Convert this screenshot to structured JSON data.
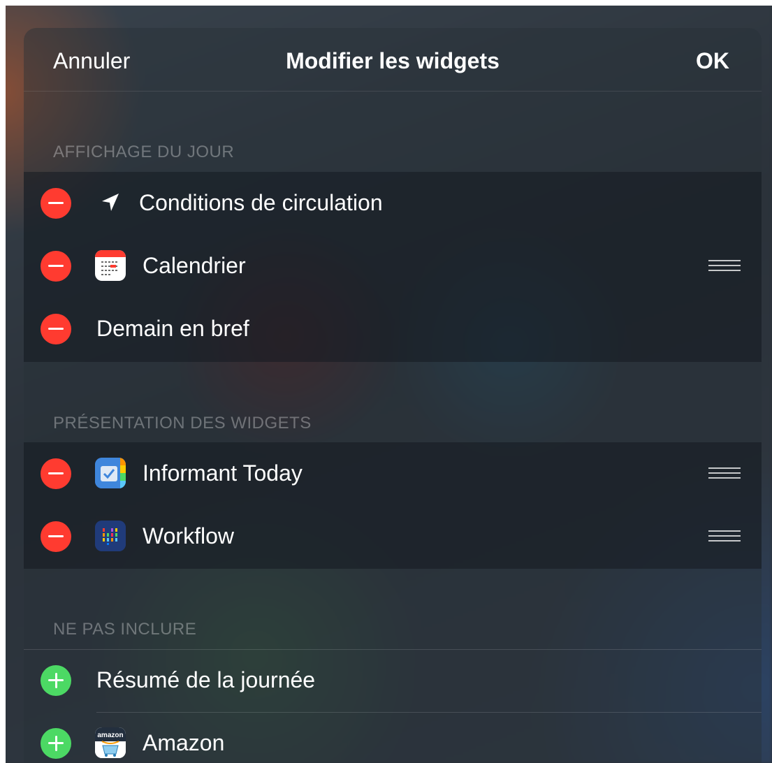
{
  "navbar": {
    "cancel_label": "Annuler",
    "title": "Modifier les widgets",
    "ok_label": "OK"
  },
  "sections": [
    {
      "header": "AFFICHAGE DU JOUR",
      "items": [
        {
          "label": "Conditions de circulation",
          "icon": "location-arrow-icon",
          "action": "remove",
          "reorder": false
        },
        {
          "label": "Calendrier",
          "icon": "calendar-app-icon",
          "action": "remove",
          "reorder": true
        },
        {
          "label": "Demain en bref",
          "icon": null,
          "action": "remove",
          "reorder": false
        }
      ]
    },
    {
      "header": "PRÉSENTATION DES WIDGETS",
      "items": [
        {
          "label": "Informant Today",
          "icon": "informant-app-icon",
          "action": "remove",
          "reorder": true
        },
        {
          "label": "Workflow",
          "icon": "workflow-app-icon",
          "action": "remove",
          "reorder": true
        }
      ]
    },
    {
      "header": "NE PAS INCLURE",
      "items": [
        {
          "label": "Résumé de la journée",
          "icon": null,
          "action": "add"
        },
        {
          "label": "Amazon",
          "icon": "amazon-app-icon",
          "icon_text": "amazon",
          "action": "add"
        }
      ]
    }
  ],
  "colors": {
    "remove": "#ff3b30",
    "add": "#4cd964",
    "text": "#ffffff",
    "section_header": "rgba(255,255,255,0.32)"
  }
}
